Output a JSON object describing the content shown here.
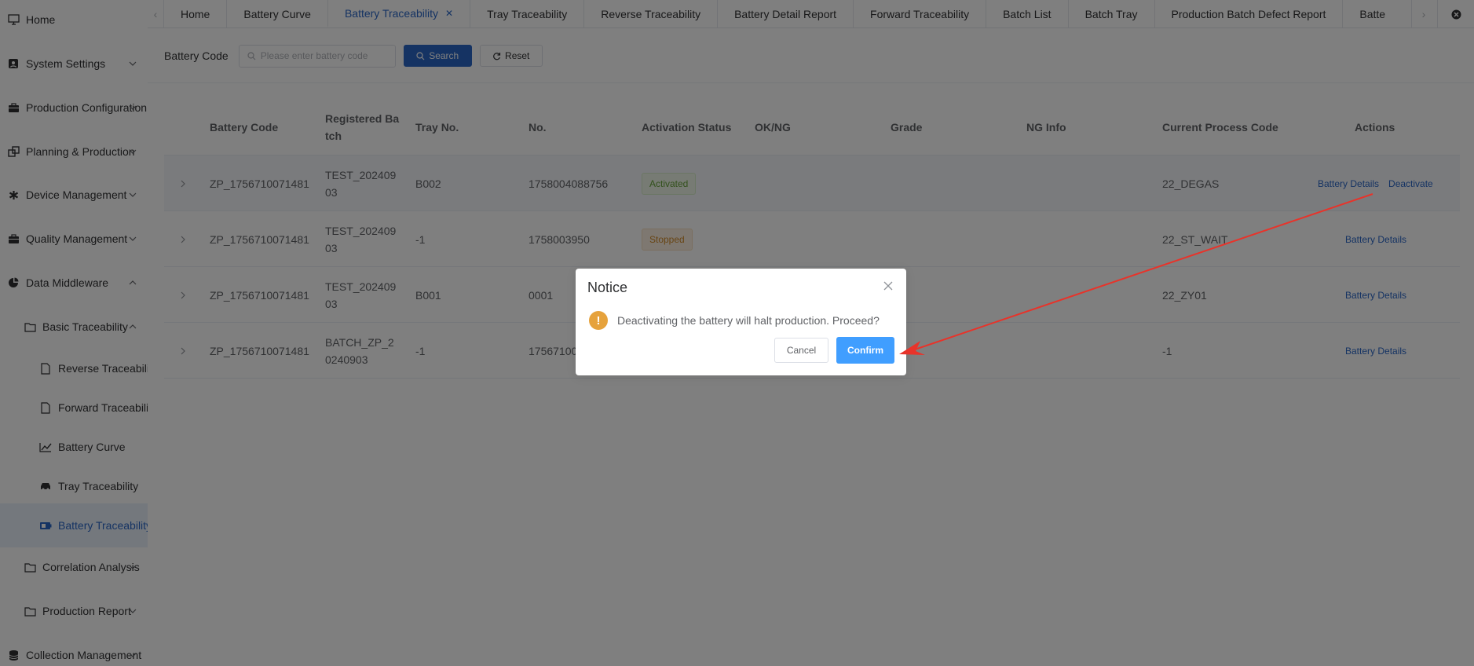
{
  "sidebar": {
    "items": [
      {
        "label": "Home",
        "icon": "monitor-icon"
      },
      {
        "label": "System Settings",
        "icon": "settings-card-icon"
      },
      {
        "label": "Production Configuration",
        "icon": "briefcase-icon"
      },
      {
        "label": "Planning & Production",
        "icon": "copy-icon"
      },
      {
        "label": "Device Management",
        "icon": "asterisk-icon"
      },
      {
        "label": "Quality Management",
        "icon": "briefcase-icon"
      },
      {
        "label": "Data Middleware",
        "icon": "pie-chart-icon"
      },
      {
        "label": "Basic Traceability",
        "icon": "folder-icon"
      },
      {
        "label": "Reverse Traceability",
        "icon": "document-icon"
      },
      {
        "label": "Forward Traceability",
        "icon": "document-icon"
      },
      {
        "label": "Battery Curve",
        "icon": "line-chart-icon"
      },
      {
        "label": "Tray Traceability",
        "icon": "car-icon"
      },
      {
        "label": "Battery Traceability",
        "icon": "battery-icon"
      },
      {
        "label": "Correlation Analysis",
        "icon": "folder-icon"
      },
      {
        "label": "Production Report",
        "icon": "folder-icon"
      },
      {
        "label": "Collection Management",
        "icon": "database-icon"
      }
    ]
  },
  "tabs": [
    {
      "label": "Home"
    },
    {
      "label": "Battery Curve"
    },
    {
      "label": "Battery Traceability",
      "active": true
    },
    {
      "label": "Tray Traceability"
    },
    {
      "label": "Reverse Traceability"
    },
    {
      "label": "Battery Detail Report"
    },
    {
      "label": "Forward Traceability"
    },
    {
      "label": "Batch List"
    },
    {
      "label": "Batch Tray"
    },
    {
      "label": "Production Batch Defect Report"
    },
    {
      "label": "Batte"
    }
  ],
  "search": {
    "label": "Battery Code",
    "placeholder": "Please enter battery code",
    "search_button": "Search",
    "reset_button": "Reset"
  },
  "table": {
    "headers": [
      "Battery Code",
      "Registered Ba\ntch",
      "Tray No.",
      "No.",
      "Activation Status",
      "OK/NG",
      "Grade",
      "NG Info",
      "Current Process Code",
      "Actions"
    ],
    "rows": [
      {
        "code": "ZP_1756710071481",
        "batch": "TEST_202409\n03",
        "tray": "B002",
        "no": "1758004088756",
        "status": "Activated",
        "process": "22_DEGAS",
        "actions": [
          "Battery Details",
          "Deactivate"
        ]
      },
      {
        "code": "ZP_1756710071481",
        "batch": "TEST_202409\n03",
        "tray": "-1",
        "no": "1758003950",
        "status": "Stopped",
        "process": "22_ST_WAIT",
        "actions": [
          "Battery Details"
        ]
      },
      {
        "code": "ZP_1756710071481",
        "batch": "TEST_202409\n03",
        "tray": "B001",
        "no": "0001",
        "status": "",
        "process": "22_ZY01",
        "actions": [
          "Battery Details"
        ]
      },
      {
        "code": "ZP_1756710071481",
        "batch": "BATCH_ZP_2\n0240903",
        "tray": "-1",
        "no": "17567100",
        "status": "",
        "process": "-1",
        "actions": [
          "Battery Details"
        ]
      }
    ]
  },
  "dialog": {
    "title": "Notice",
    "message": "Deactivating the battery will halt production. Proceed?",
    "cancel": "Cancel",
    "confirm": "Confirm"
  },
  "colors": {
    "primary": "#2a66c7",
    "confirm": "#409eff",
    "warning": "#e6a23c",
    "annotation_arrow": "#e8332a"
  }
}
